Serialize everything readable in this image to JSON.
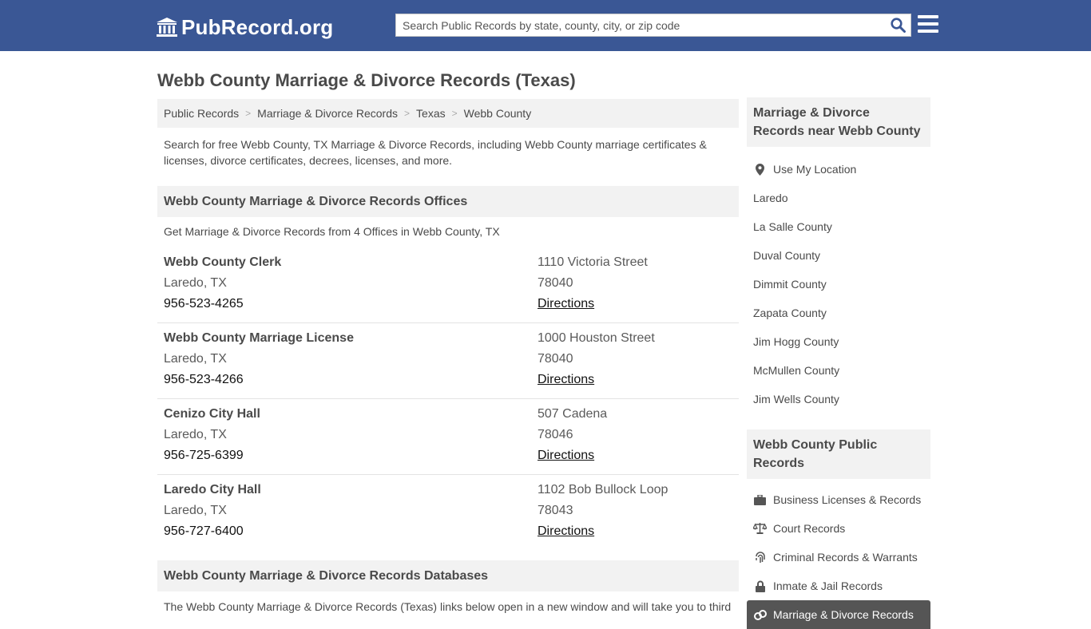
{
  "header": {
    "logo_text": "PubRecord.org",
    "search_placeholder": "Search Public Records by state, county, city, or zip code",
    "brand_color": "#3a5795"
  },
  "page_title": "Webb County Marriage & Divorce Records (Texas)",
  "breadcrumb": [
    "Public Records",
    "Marriage & Divorce Records",
    "Texas",
    "Webb County"
  ],
  "intro": "Search for free Webb County, TX Marriage & Divorce Records, including Webb County marriage certificates & licenses, divorce certificates, decrees, licenses, and more.",
  "offices_section": {
    "title": "Webb County Marriage & Divorce Records Offices",
    "subtitle": "Get Marriage & Divorce Records from 4 Offices in Webb County, TX",
    "offices": [
      {
        "name": "Webb County Clerk",
        "city": "Laredo, TX",
        "phone": "956-523-4265",
        "street": "1110 Victoria Street",
        "zip": "78040",
        "directions": "Directions"
      },
      {
        "name": "Webb County Marriage License",
        "city": "Laredo, TX",
        "phone": "956-523-4266",
        "street": "1000 Houston Street",
        "zip": "78040",
        "directions": "Directions"
      },
      {
        "name": "Cenizo City Hall",
        "city": "Laredo, TX",
        "phone": "956-725-6399",
        "street": "507 Cadena",
        "zip": "78046",
        "directions": "Directions"
      },
      {
        "name": "Laredo City Hall",
        "city": "Laredo, TX",
        "phone": "956-727-6400",
        "street": "1102 Bob Bullock Loop",
        "zip": "78043",
        "directions": "Directions"
      }
    ]
  },
  "databases_section": {
    "title": "Webb County Marriage & Divorce Records Databases",
    "intro": "The Webb County Marriage & Divorce Records (Texas) links below open in a new window and will take you to third"
  },
  "sidebar": {
    "near_title": "Marriage & Divorce Records near Webb County",
    "use_location": "Use My Location",
    "near_items": [
      "Laredo",
      "La Salle County",
      "Duval County",
      "Dimmit County",
      "Zapata County",
      "Jim Hogg County",
      "McMullen County",
      "Jim Wells County"
    ],
    "public_title": "Webb County Public Records",
    "public_items": [
      {
        "label": "Business Licenses & Records",
        "icon": "briefcase-icon"
      },
      {
        "label": "Court Records",
        "icon": "scales-icon"
      },
      {
        "label": "Criminal Records & Warrants",
        "icon": "fingerprint-icon"
      },
      {
        "label": "Inmate & Jail Records",
        "icon": "lock-icon"
      },
      {
        "label": "Marriage & Divorce Records",
        "icon": "rings-icon"
      }
    ]
  }
}
